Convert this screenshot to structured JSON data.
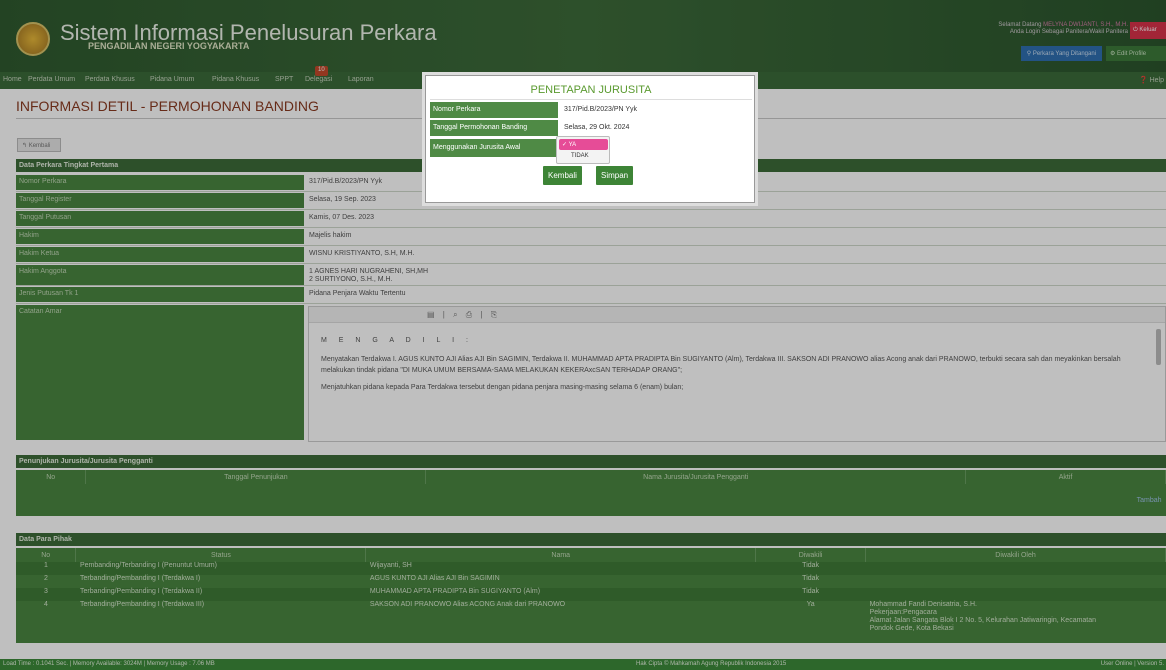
{
  "header": {
    "title": "Sistem Informasi Penelusuran Perkara",
    "subtitle": "PENGADILAN NEGERI YOGYAKARTA",
    "welcome_prefix": "Selamat Datang",
    "welcome_user": "MELYNA DWIJANTI, S.H., M.H.",
    "welcome_role": "Anda Login Sebagai Panitera/Wakil Panitera",
    "logout": "⏻ Keluar",
    "perkara_button": "⚲ Perkara Yang Ditangani",
    "profile_button": "⚙ Edit Profile"
  },
  "nav": {
    "items": [
      "Home",
      "Perdata Umum",
      "Perdata Khusus",
      "Pidana Umum",
      "Pidana Khusus",
      "SPPT",
      "Delegasi",
      "Laporan"
    ],
    "delegasi_badge": "10",
    "help": "❓ Help"
  },
  "page": {
    "title": "INFORMASI DETIL - PERMOHONAN BANDING",
    "back": "↰ Kembali"
  },
  "first_instance": {
    "section": "Data Perkara Tingkat Pertama",
    "rows": [
      {
        "label": "Nomor Perkara",
        "value": "317/Pid.B/2023/PN Yyk"
      },
      {
        "label": "Tanggal Register",
        "value": "Selasa, 19 Sep. 2023"
      },
      {
        "label": "Tanggal Putusan",
        "value": "Kamis, 07 Des. 2023"
      },
      {
        "label": "Hakim",
        "value": "Majelis hakim"
      },
      {
        "label": "Hakim Ketua",
        "value": "WISNU KRISTIYANTO, S.H, M.H."
      },
      {
        "label": "Hakim Anggota",
        "value": "1 AGNES HARI NUGRAHENI, SH,MH",
        "value2": "2 SURTIYONO, S.H., M.H."
      },
      {
        "label": "Jenis Putusan Tk 1",
        "value": "Pidana Penjara Waktu Tertentu"
      },
      {
        "label": "Catatan Amar"
      }
    ],
    "amar": {
      "heading": "M E N G A D I L I :",
      "p1": "Menyatakan Terdakwa I. AGUS KUNTO AJI Alias AJI Bin SAGIMIN, Terdakwa II. MUHAMMAD APTA PRADIPTA Bin SUGIYANTO (Alm), Terdakwa III. SAKSON ADI PRANOWO alias Acong anak dari PRANOWO, terbukti secara sah dan meyakinkan bersalah melakukan tindak pidana \"DI MUKA UMUM  BERSAMA-SAMA MELAKUKAN KEKERAxcSAN TERHADAP ORANG\";",
      "p2": "Menjatuhkan pidana kepada Para Terdakwa tersebut dengan pidana penjara masing-masing selama 6 (enam) bulan;"
    }
  },
  "jurusita_section": {
    "title": "Penunjukan Jurusita/Jurusita Pengganti",
    "columns": [
      "No",
      "Tanggal Penunjukan",
      "Nama Jurusita/Jurusita Pengganti",
      "Aktif"
    ],
    "add_button": "Tambah"
  },
  "parties": {
    "title": "Data Para Pihak",
    "columns": [
      "No",
      "Status",
      "Nama",
      "Diwakili",
      "Diwakili Oleh"
    ],
    "rows": [
      {
        "no": "1",
        "status": "Pembanding/Terbanding I (Penuntut Umum)",
        "nama": "Wijayanti, SH",
        "diwakili": "Tidak",
        "oleh": ""
      },
      {
        "no": "2",
        "status": "Terbanding/Pembanding I (Terdakwa I)",
        "nama": "AGUS KUNTO AJI Alias AJI Bin SAGIMIN",
        "diwakili": "Tidak",
        "oleh": ""
      },
      {
        "no": "3",
        "status": "Terbanding/Pembanding I (Terdakwa II)",
        "nama": "MUHAMMAD APTA PRADIPTA Bin SUGIYANTO (Alm)",
        "diwakili": "Tidak",
        "oleh": ""
      },
      {
        "no": "4",
        "status": "Terbanding/Pembanding I (Terdakwa III)",
        "nama": "SAKSON ADI PRANOWO Alias ACONG Anak dari PRANOWO",
        "diwakili": "Ya",
        "oleh": "Mohammad Fandi Denisatria, S.H.",
        "oleh2": "Pekerjaan:Pengacara",
        "oleh3": "Alamat Jalan Sangata Blok I 2 No. 5, Kelurahan Jatiwaringin, Kecamatan",
        "oleh4": "Pondok Gede, Kota Bekasi"
      }
    ]
  },
  "modal": {
    "title": "PENETAPAN JURUSITA",
    "nomor_label": "Nomor Perkara",
    "nomor_value": "317/Pid.B/2023/PN Yyk",
    "tanggal_label": "Tanggal Permohonan Banding",
    "tanggal_value": "Selasa, 29 Okt. 2024",
    "jurusita_label": "Menggunakan Jurusita Awal",
    "options": [
      "YA",
      "TIDAK"
    ],
    "selected": "✓ YA",
    "btn_back": "Kembali",
    "btn_save": "Simpan"
  },
  "footer": {
    "left": "Load Time : 0.1041 Sec. | Memory Available: 3024M | Memory Usage : 7.06 MB",
    "center": "Hak Cipta © Mahkamah Agung Republik Indonesia 2015",
    "right": "User Online | Version 5."
  }
}
